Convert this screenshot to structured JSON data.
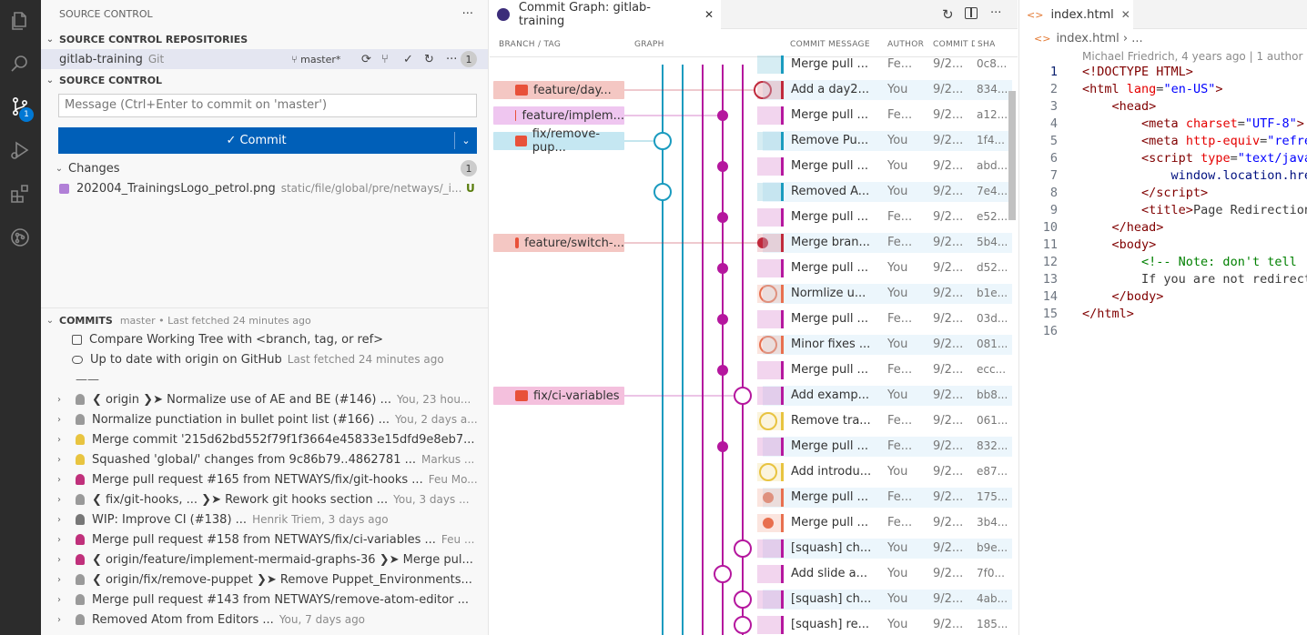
{
  "activity_bar": {
    "icons": [
      "files-icon",
      "search-icon",
      "source-control-icon",
      "run-debug-icon",
      "extensions-icon",
      "gitlens-icon"
    ],
    "scm_badge": "1"
  },
  "scm": {
    "header": "SOURCE CONTROL",
    "more": "···",
    "repos_title": "SOURCE CONTROL REPOSITORIES",
    "repo_name": "gitlab-training",
    "repo_type": "Git",
    "branch": "master*",
    "repo_count": "1",
    "sc_title": "SOURCE CONTROL",
    "message_placeholder": "Message (Ctrl+Enter to commit on 'master')",
    "commit_label": "✓ Commit",
    "changes_label": "Changes",
    "changes_count": "1",
    "changed_file": "202004_TrainingsLogo_petrol.png",
    "changed_path": "static/file/global/pre/netways/_i...",
    "changed_status": "U"
  },
  "commits": {
    "title": "COMMITS",
    "meta": "master • Last fetched 24 minutes ago",
    "compare": "Compare Working Tree with <branch, tag, or ref>",
    "uptodate": "Up to date with origin on GitHub",
    "uptodate_meta": "Last fetched 24 minutes ago",
    "divider": "——",
    "items": [
      {
        "text": "❮ origin ❯➤ Normalize use of AE and BE (#146) ...",
        "meta": "You, 23 hou..."
      },
      {
        "text": "Normalize punctiation in bullet point list (#166) ...",
        "meta": "You, 2 days a..."
      },
      {
        "text": "Merge commit '215d62bd552f79f1f3664e45833e15dfd9e8eb7...",
        "meta": ""
      },
      {
        "text": "Squashed 'global/' changes from 9c86b79..4862781 ...",
        "meta": "Markus ..."
      },
      {
        "text": "Merge pull request #165 from NETWAYS/fix/git-hooks ...",
        "meta": "Feu Mo..."
      },
      {
        "text": "❮ fix/git-hooks, ... ❯➤ Rework git hooks section ...",
        "meta": "You, 3 days ..."
      },
      {
        "text": "WIP: Improve CI (#138) ...",
        "meta": "Henrik Triem, 3 days ago"
      },
      {
        "text": "Merge pull request #158 from NETWAYS/fix/ci-variables ...",
        "meta": "Feu ..."
      },
      {
        "text": "❮ origin/feature/implement-mermaid-graphs-36 ❯➤ Merge pul...",
        "meta": ""
      },
      {
        "text": "❮ origin/fix/remove-puppet ❯➤ Remove Puppet_Environments...",
        "meta": ""
      },
      {
        "text": "Merge pull request #143 from NETWAYS/remove-atom-editor ...",
        "meta": ""
      },
      {
        "text": "Removed Atom from Editors ...",
        "meta": "You, 7 days ago"
      }
    ]
  },
  "graph_tab": {
    "title": "Commit Graph: gitlab-training",
    "close": "✕",
    "columns": [
      "BRANCH / TAG",
      "GRAPH",
      "COMMIT MESSAGE",
      "AUTHOR",
      "COMMIT D",
      "SHA"
    ],
    "rows": [
      {
        "branch": "",
        "msg": "Merge pull ...",
        "author": "Fe...",
        "date": "9/2...",
        "sha": "0c8...",
        "color": "#1a9bbf"
      },
      {
        "branch": "feature/day...",
        "msg": "Add a day2...",
        "author": "You",
        "date": "9/2...",
        "sha": "834...",
        "color": "#c0293b"
      },
      {
        "branch": "feature/implem...",
        "msg": "Merge pull ...",
        "author": "Fe...",
        "date": "9/2...",
        "sha": "a12...",
        "color": "#b5179e"
      },
      {
        "branch": "fix/remove-pup...",
        "msg": "Remove Pu...",
        "author": "You",
        "date": "9/2...",
        "sha": "1f4...",
        "color": "#1a9bbf"
      },
      {
        "branch": "",
        "msg": "Merge pull ...",
        "author": "You",
        "date": "9/2...",
        "sha": "abd...",
        "color": "#b5179e"
      },
      {
        "branch": "",
        "msg": "Removed A...",
        "author": "You",
        "date": "9/2...",
        "sha": "7e4...",
        "color": "#1a9bbf"
      },
      {
        "branch": "",
        "msg": "Merge pull ...",
        "author": "Fe...",
        "date": "9/2...",
        "sha": "e52...",
        "color": "#b5179e"
      },
      {
        "branch": "feature/switch-...",
        "msg": "Merge bran...",
        "author": "Fe...",
        "date": "9/2...",
        "sha": "5b4...",
        "color": "#c0293b"
      },
      {
        "branch": "",
        "msg": "Merge pull ...",
        "author": "You",
        "date": "9/2...",
        "sha": "d52...",
        "color": "#b5179e"
      },
      {
        "branch": "",
        "msg": "Normlize u...",
        "author": "You",
        "date": "9/2...",
        "sha": "b1e...",
        "color": "#e8704f"
      },
      {
        "branch": "",
        "msg": "Merge pull ...",
        "author": "Fe...",
        "date": "9/2...",
        "sha": "03d...",
        "color": "#b5179e"
      },
      {
        "branch": "",
        "msg": "Minor fixes ...",
        "author": "You",
        "date": "9/2...",
        "sha": "081...",
        "color": "#e8704f"
      },
      {
        "branch": "",
        "msg": "Merge pull ...",
        "author": "Fe...",
        "date": "9/2...",
        "sha": "ecc...",
        "color": "#b5179e"
      },
      {
        "branch": "fix/ci-variables",
        "msg": "Add examp...",
        "author": "You",
        "date": "9/2...",
        "sha": "bb8...",
        "color": "#b5179e"
      },
      {
        "branch": "",
        "msg": "Remove tra...",
        "author": "Fe...",
        "date": "9/2...",
        "sha": "061...",
        "color": "#e8c440"
      },
      {
        "branch": "",
        "msg": "Merge pull ...",
        "author": "Fe...",
        "date": "9/2...",
        "sha": "832...",
        "color": "#b5179e"
      },
      {
        "branch": "",
        "msg": "Add introdu...",
        "author": "You",
        "date": "9/2...",
        "sha": "e87...",
        "color": "#e8c440"
      },
      {
        "branch": "",
        "msg": "Merge pull ...",
        "author": "Fe...",
        "date": "9/2...",
        "sha": "175...",
        "color": "#e8704f"
      },
      {
        "branch": "",
        "msg": "Merge pull ...",
        "author": "Fe...",
        "date": "9/2...",
        "sha": "3b4...",
        "color": "#e8704f"
      },
      {
        "branch": "",
        "msg": "[squash] ch...",
        "author": "You",
        "date": "9/2...",
        "sha": "b9e...",
        "color": "#b5179e"
      },
      {
        "branch": "",
        "msg": "Add slide a...",
        "author": "You",
        "date": "9/2...",
        "sha": "7f0...",
        "color": "#b5179e"
      },
      {
        "branch": "",
        "msg": "[squash] ch...",
        "author": "You",
        "date": "9/2...",
        "sha": "4ab...",
        "color": "#b5179e"
      },
      {
        "branch": "",
        "msg": "[squash] re...",
        "author": "You",
        "date": "9/2...",
        "sha": "185...",
        "color": "#b5179e"
      }
    ]
  },
  "file_tab": {
    "title": "index.html",
    "close": "✕",
    "breadcrumb": "index.html",
    "breadcrumb_more": "› ...",
    "blame": "Michael Friedrich, 4 years ago | 1 author (",
    "lines": [
      "1",
      "2",
      "3",
      "4",
      "5",
      "6",
      "7",
      "8",
      "9",
      "10",
      "11",
      "12",
      "13",
      "14",
      "15",
      "16"
    ]
  }
}
